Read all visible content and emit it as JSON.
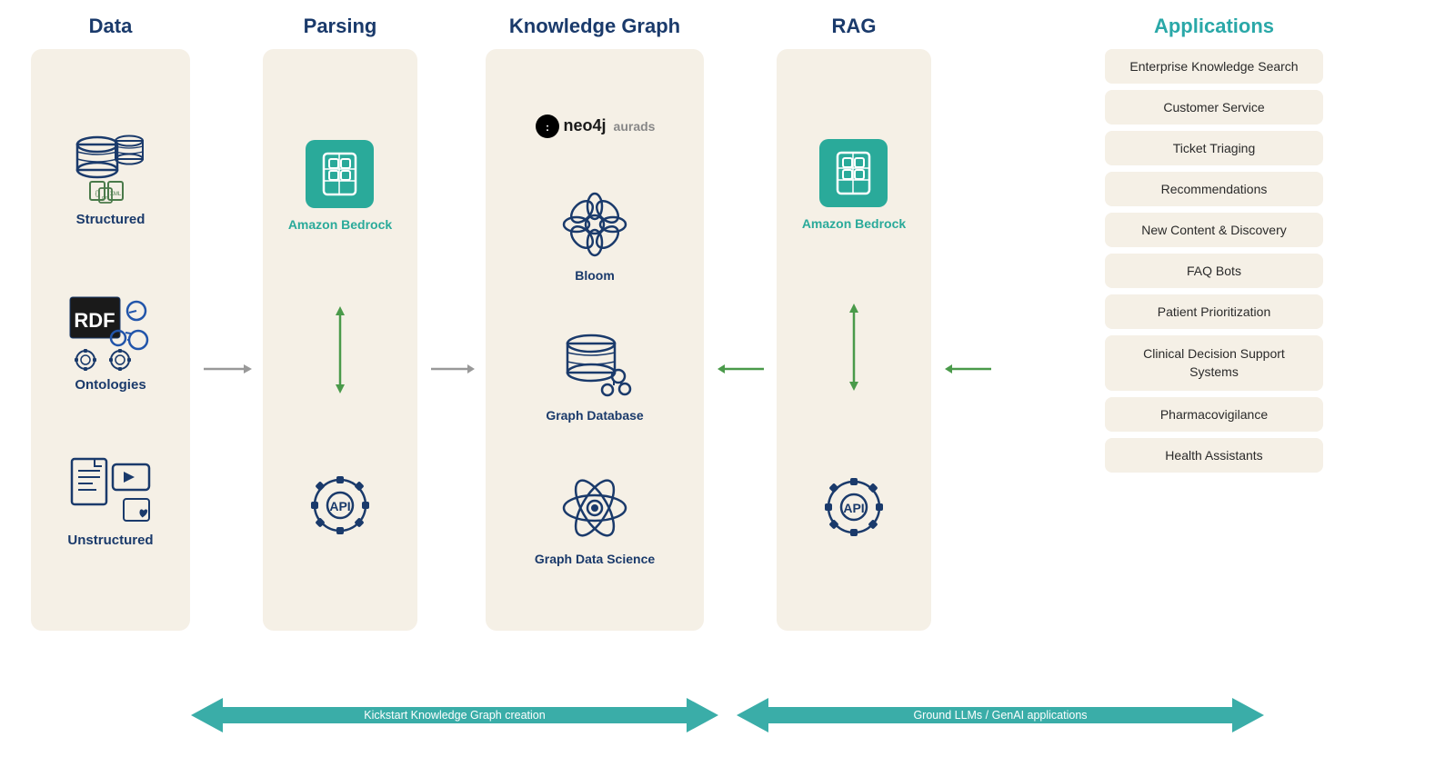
{
  "columns": {
    "data": {
      "title": "Data",
      "items": [
        {
          "label": "Structured",
          "icon": "database-stack"
        },
        {
          "label": "Ontologies",
          "icon": "rdf-ontology"
        },
        {
          "label": "Unstructured",
          "icon": "unstructured-files"
        }
      ]
    },
    "parsing": {
      "title": "Parsing",
      "items": [
        {
          "label": "Amazon Bedrock",
          "icon": "bedrock-logo"
        },
        {
          "label": "API",
          "icon": "api-gear"
        }
      ]
    },
    "kg": {
      "title": "Knowledge Graph",
      "logo": ":neo4j aurads",
      "items": [
        {
          "label": "Bloom",
          "icon": "bloom-flower"
        },
        {
          "label": "Graph Database",
          "icon": "graph-db"
        },
        {
          "label": "Graph Data Science",
          "icon": "graph-data-science"
        }
      ]
    },
    "rag": {
      "title": "RAG",
      "items": [
        {
          "label": "Amazon Bedrock",
          "icon": "bedrock-logo"
        },
        {
          "label": "API",
          "icon": "api-gear"
        }
      ]
    },
    "apps": {
      "title": "Applications",
      "items": [
        "Enterprise Knowledge Search",
        "Customer Service",
        "Ticket Triaging",
        "Recommendations",
        "New Content & Discovery",
        "FAQ Bots",
        "Patient Prioritization",
        "Clinical Decision Support Systems",
        "Pharmacovigilance",
        "Health Assistants"
      ]
    }
  },
  "arrows": {
    "bottom_left_label": "Kickstart Knowledge Graph creation",
    "bottom_right_label": "Ground LLMs / GenAI applications"
  }
}
